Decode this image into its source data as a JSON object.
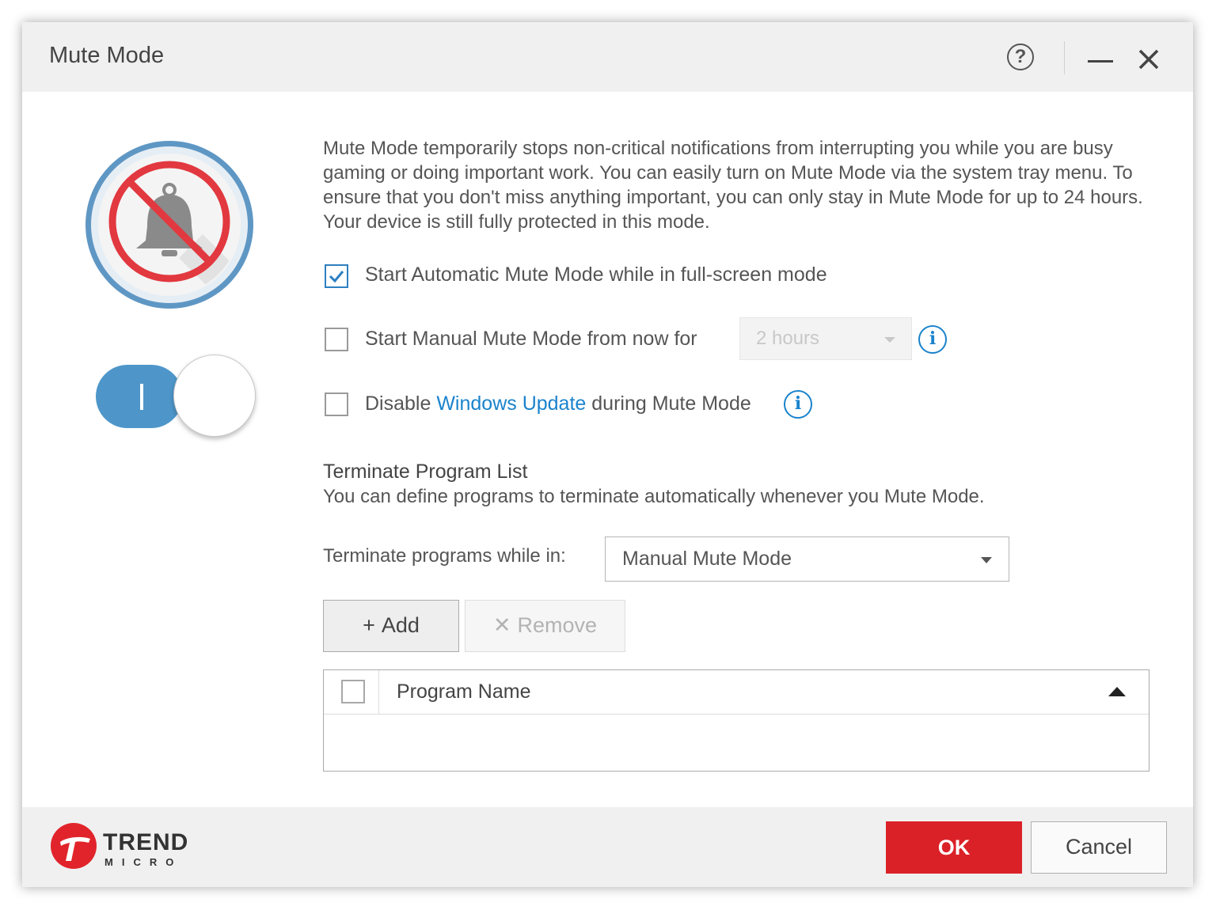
{
  "window": {
    "title": "Mute Mode",
    "help_glyph": "?"
  },
  "main": {
    "description": "Mute Mode temporarily stops non-critical notifications from interrupting you while you are busy gaming or doing important work. You can easily turn on Mute Mode via the system tray menu. To ensure that you don't miss anything important, you can only stay in Mute Mode for up to 24 hours. Your device is still fully protected in this mode.",
    "toggle_glyph": "I",
    "toggle_state": "on",
    "options": {
      "auto_label": "Start Automatic Mute Mode while in full-screen mode",
      "auto_checked": true,
      "manual_label": "Start Manual Mute Mode from now for",
      "manual_checked": false,
      "manual_duration": "2 hours",
      "disable_prefix": "Disable ",
      "disable_link": "Windows Update",
      "disable_suffix": " during Mute Mode",
      "disable_checked": false,
      "info_glyph": "i"
    },
    "terminate": {
      "title": "Terminate Program List",
      "description": "You can define programs to terminate automatically whenever you Mute Mode.",
      "label": "Terminate programs while in:",
      "selected": "Manual Mute Mode",
      "add_glyph": "+",
      "add_label": "Add",
      "remove_glyph": "✕",
      "remove_label": "Remove",
      "table": {
        "column": "Program Name",
        "rows": []
      }
    }
  },
  "footer": {
    "logo_top": "TREND",
    "logo_bottom": "MICRO",
    "ok_label": "OK",
    "cancel_label": "Cancel"
  },
  "colors": {
    "accent": "#1a83cc",
    "toggle": "#4e96c9",
    "ok_red": "#db2128",
    "titlebar": "#f0f0f0"
  },
  "icons": [
    "help-icon",
    "minimize-icon",
    "close-icon",
    "mute-bell-icon",
    "check-icon",
    "info-icon",
    "plus-icon",
    "remove-x-icon",
    "sort-up-icon",
    "trend-micro-logo"
  ]
}
